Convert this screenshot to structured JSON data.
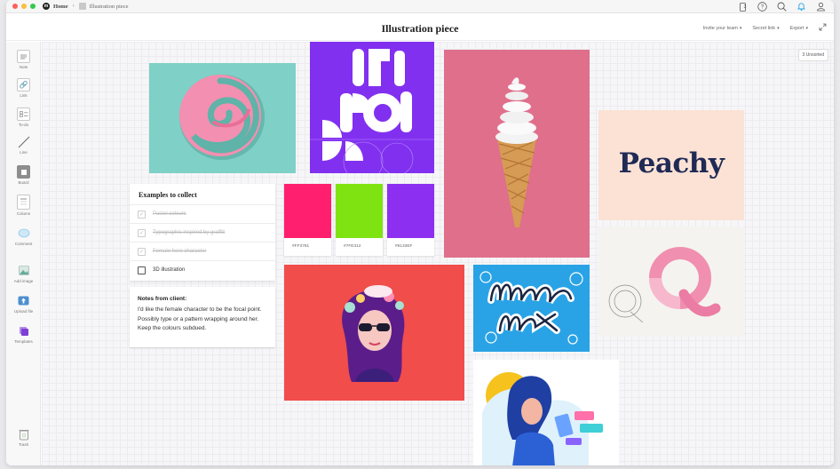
{
  "chrome": {
    "home_label": "Home",
    "breadcrumb_page": "Illustration piece",
    "device_count": "3"
  },
  "header": {
    "title": "Illustration piece",
    "invite_label": "Invite your team",
    "secret_link_label": "Secret link",
    "export_label": "Export"
  },
  "sidebar": {
    "items": [
      {
        "label": "Note",
        "icon": "note-icon"
      },
      {
        "label": "Link",
        "icon": "link-icon"
      },
      {
        "label": "To-do",
        "icon": "todo-icon"
      },
      {
        "label": "Line",
        "icon": "line-icon"
      },
      {
        "label": "Board",
        "icon": "board-icon"
      },
      {
        "label": "Column",
        "icon": "column-icon"
      },
      {
        "label": "Comment",
        "icon": "comment-icon"
      },
      {
        "label": "Add image",
        "icon": "image-icon"
      },
      {
        "label": "Upload file",
        "icon": "upload-icon"
      },
      {
        "label": "Templates",
        "icon": "templates-icon"
      }
    ],
    "trash_label": "Trash"
  },
  "canvas": {
    "unsorted_label": "3 Unsorted",
    "todo": {
      "title": "Examples to collect",
      "items": [
        {
          "text": "Pastel colours",
          "done": true
        },
        {
          "text": "Typographic inspired by graffiti",
          "done": true
        },
        {
          "text": "Female hero character",
          "done": true
        },
        {
          "text": "3D illustration",
          "done": false
        }
      ]
    },
    "note": {
      "title": "Notes from client:",
      "body": "I'd like the female character to be the focal point. Possibly type or a pattern wrapping around her. Keep the colours subdued."
    },
    "swatches": [
      {
        "hex_label": "#FF3781",
        "color": "#ff1f6e"
      },
      {
        "hex_label": "#7FE312",
        "color": "#7fe312"
      },
      {
        "hex_label": "#9133EF",
        "color": "#8d2ff0"
      }
    ],
    "peachy_text": "Peachy"
  },
  "colors": {
    "teal": "#7fd0c6",
    "purple": "#8230f0",
    "pink": "#e06f8b",
    "peach": "#fbe2d5",
    "coral": "#f04d4b",
    "navy": "#1f2a55"
  }
}
